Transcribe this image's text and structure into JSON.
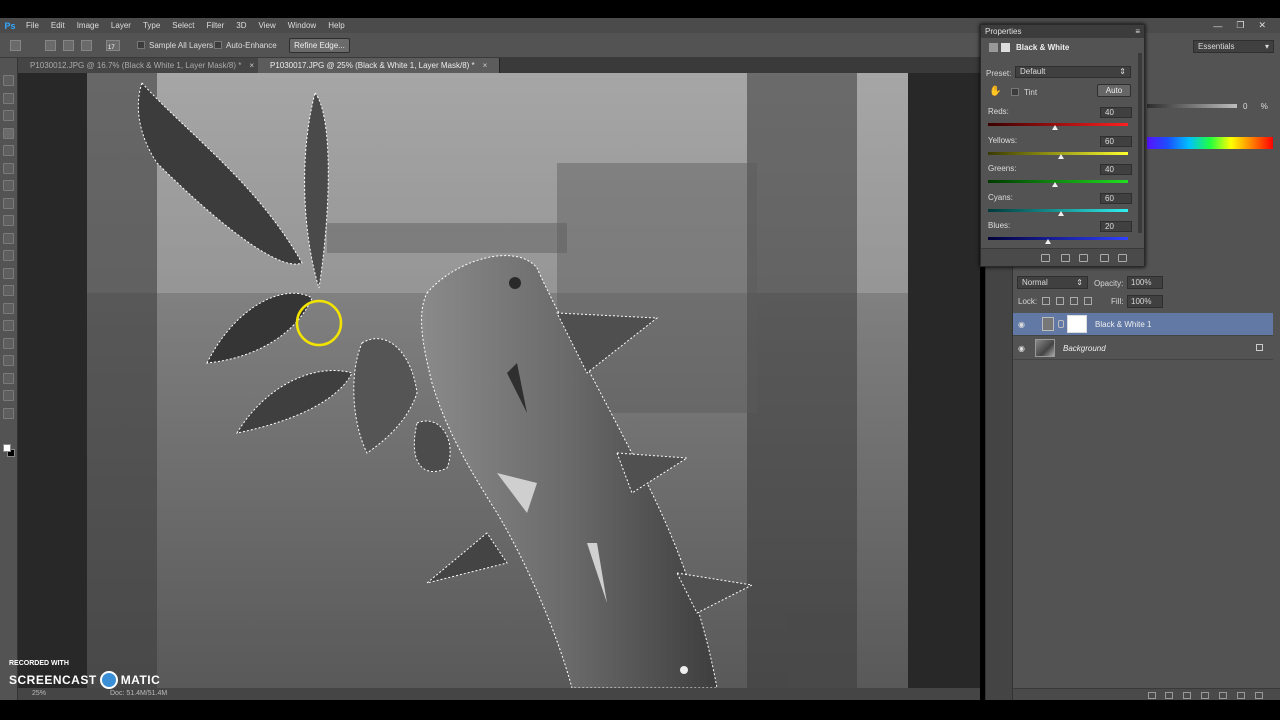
{
  "menu": [
    "File",
    "Edit",
    "Image",
    "Layer",
    "Type",
    "Select",
    "Filter",
    "3D",
    "View",
    "Window",
    "Help"
  ],
  "options_bar": {
    "sample_all_layers": "Sample All Layers",
    "auto_enhance": "Auto-Enhance",
    "refine_edge": "Refine Edge...",
    "brush_size": "17"
  },
  "workspace": "Essentials",
  "tabs": [
    {
      "label": "P1030012.JPG @ 16.7% (Black & White 1, Layer Mask/8) *",
      "active": false
    },
    {
      "label": "P1030017.JPG @ 25% (Black & White 1, Layer Mask/8) *",
      "active": true
    }
  ],
  "status": {
    "zoom": "25%",
    "doc": "Doc: 51.4M/51.4M"
  },
  "watermark": {
    "recorded": "RECORDED WITH",
    "brand_left": "SCREENCAST",
    "brand_right": "MATIC"
  },
  "color_panel": {
    "value": "0",
    "pct": "%"
  },
  "properties": {
    "header": "Properties",
    "title": "Black & White",
    "preset_label": "Preset:",
    "preset_value": "Default",
    "tint_label": "Tint",
    "auto_label": "Auto",
    "sliders": [
      {
        "label": "Reds:",
        "value": "40",
        "fraction": 0.475,
        "colors": [
          "#3a0000",
          "#ff2020"
        ]
      },
      {
        "label": "Yellows:",
        "value": "60",
        "fraction": 0.52,
        "colors": [
          "#3a3a00",
          "#ffff30"
        ]
      },
      {
        "label": "Greens:",
        "value": "40",
        "fraction": 0.475,
        "colors": [
          "#003a00",
          "#20e020"
        ]
      },
      {
        "label": "Cyans:",
        "value": "60",
        "fraction": 0.52,
        "colors": [
          "#003a3a",
          "#30f0f0"
        ]
      },
      {
        "label": "Blues:",
        "value": "20",
        "fraction": 0.43,
        "colors": [
          "#00003a",
          "#3040ff"
        ]
      }
    ]
  },
  "layers": {
    "blend_mode": "Normal",
    "opacity_label": "Opacity:",
    "opacity": "100%",
    "lock_label": "Lock:",
    "fill_label": "Fill:",
    "fill": "100%",
    "items": [
      {
        "name": "Black & White 1",
        "selected": true
      },
      {
        "name": "Background",
        "selected": false
      }
    ]
  }
}
